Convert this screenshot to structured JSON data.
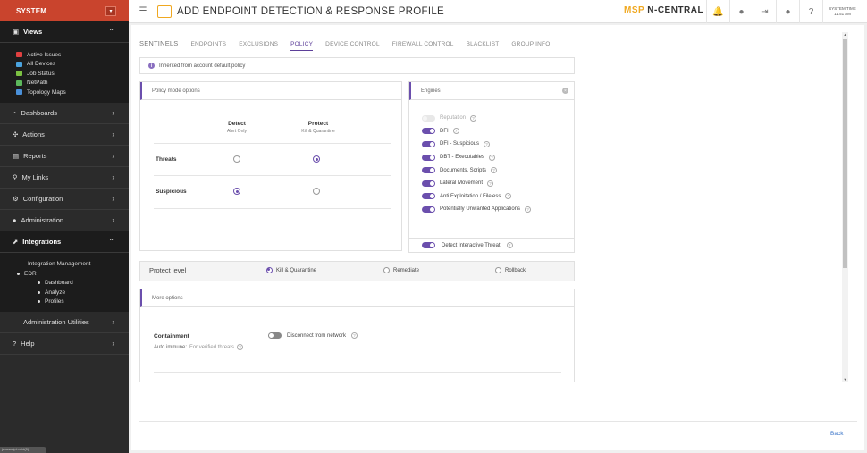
{
  "sidebar": {
    "system_label": "SYSTEM",
    "views_label": "Views",
    "views_items": [
      "Active Issues",
      "All Devices",
      "Job Status",
      "NetPath",
      "Topology Maps"
    ],
    "views_colors": [
      "#e04040",
      "#4aa3df",
      "#7cc142",
      "#5cb85c",
      "#4a90d9"
    ],
    "nav": [
      {
        "label": "Dashboards",
        "icon": "dashboard-icon"
      },
      {
        "label": "Actions",
        "icon": "actions-icon"
      },
      {
        "label": "Reports",
        "icon": "reports-icon"
      },
      {
        "label": "My Links",
        "icon": "links-icon"
      },
      {
        "label": "Configuration",
        "icon": "gear-icon"
      },
      {
        "label": "Administration",
        "icon": "user-icon"
      }
    ],
    "integrations_label": "Integrations",
    "integration_items": {
      "management": "Integration Management",
      "edr": "EDR",
      "dashboard": "Dashboard",
      "analyze": "Analyze",
      "profiles": "Profiles"
    },
    "admin_utilities": "Administration Utilities",
    "help": "Help"
  },
  "header": {
    "title": "ADD ENDPOINT DETECTION & RESPONSE PROFILE",
    "brand_msp": "MSP",
    "brand_nc": "N-CENTRAL",
    "system_time_label": "SYSTEM TIME",
    "system_time": "11:51 AM"
  },
  "tabs": [
    "SENTINELS",
    "ENDPOINTS",
    "EXCLUSIONS",
    "POLICY",
    "DEVICE CONTROL",
    "FIREWALL CONTROL",
    "BLACKLIST",
    "GROUP INFO"
  ],
  "active_tab": "POLICY",
  "inherited_text": "Inherited from account default policy",
  "policy_mode": {
    "title": "Policy mode options",
    "detect_label": "Detect",
    "detect_sub": "Alert Only",
    "protect_label": "Protect",
    "protect_sub": "Kill & Quarantine",
    "threats_label": "Threats",
    "suspicious_label": "Suspicious",
    "threats_value": "protect",
    "suspicious_value": "detect"
  },
  "engines": {
    "title": "Engines",
    "items": [
      {
        "label": "Reputation",
        "enabled": false
      },
      {
        "label": "DFI",
        "enabled": true
      },
      {
        "label": "DFI - Suspicious",
        "enabled": true
      },
      {
        "label": "DBT - Executables",
        "enabled": true
      },
      {
        "label": "Documents, Scripts",
        "enabled": true
      },
      {
        "label": "Lateral Movement",
        "enabled": true
      },
      {
        "label": "Anti Exploitation / Fileless",
        "enabled": true
      },
      {
        "label": "Potentially Unwanted Applications",
        "enabled": true
      }
    ],
    "detect_interactive": "Detect Interactive Threat"
  },
  "protect_level": {
    "label": "Protect level",
    "options": [
      "Kill & Quarantine",
      "Remediate",
      "Rollback"
    ],
    "selected": "Kill & Quarantine"
  },
  "more_options": {
    "title": "More options",
    "containment": "Containment",
    "auto_immune": "Auto immune:",
    "auto_immune_value": "For verified threats",
    "disconnect": "Disconnect from network"
  },
  "footer": {
    "back": "Back"
  },
  "status_bar": "javascript:void(0)"
}
